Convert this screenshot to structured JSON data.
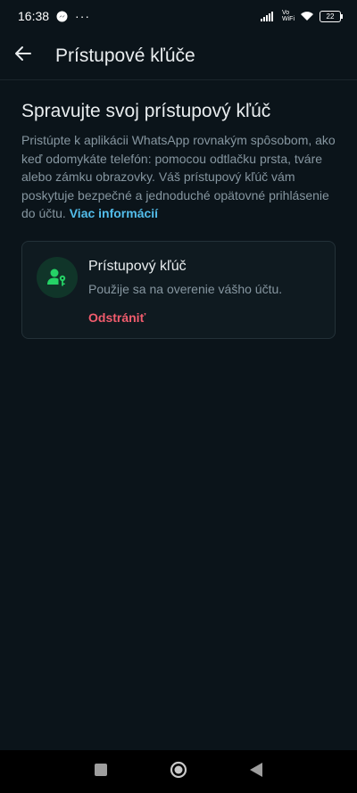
{
  "status_bar": {
    "time": "16:38",
    "dots": "···",
    "vo": "Vo",
    "wifi_label": "WiFi",
    "battery": "22"
  },
  "app_bar": {
    "back_icon": "arrow-left-icon",
    "title": "Prístupové kľúče"
  },
  "main": {
    "heading": "Spravujte svoj prístupový kľúč",
    "description": "Pristúpte k aplikácii WhatsApp rovnakým spôsobom, ako keď odomykáte telefón: pomocou odtlačku prsta, tváre alebo zámku obrazovky. Váš prístupový kľúč vám poskytuje bezpečné a jednoduché opätovné prihlásenie do účtu.",
    "learn_more": "Viac informácií"
  },
  "passkey_card": {
    "icon": "person-key-icon",
    "title": "Prístupový kľúč",
    "subtitle": "Použije sa na overenie vášho účtu.",
    "remove_label": "Odstrániť"
  },
  "colors": {
    "background": "#0b141a",
    "accent_link": "#53bdeb",
    "danger": "#f15c6d",
    "avatar_bg": "#103529",
    "avatar_fg": "#25d366"
  }
}
